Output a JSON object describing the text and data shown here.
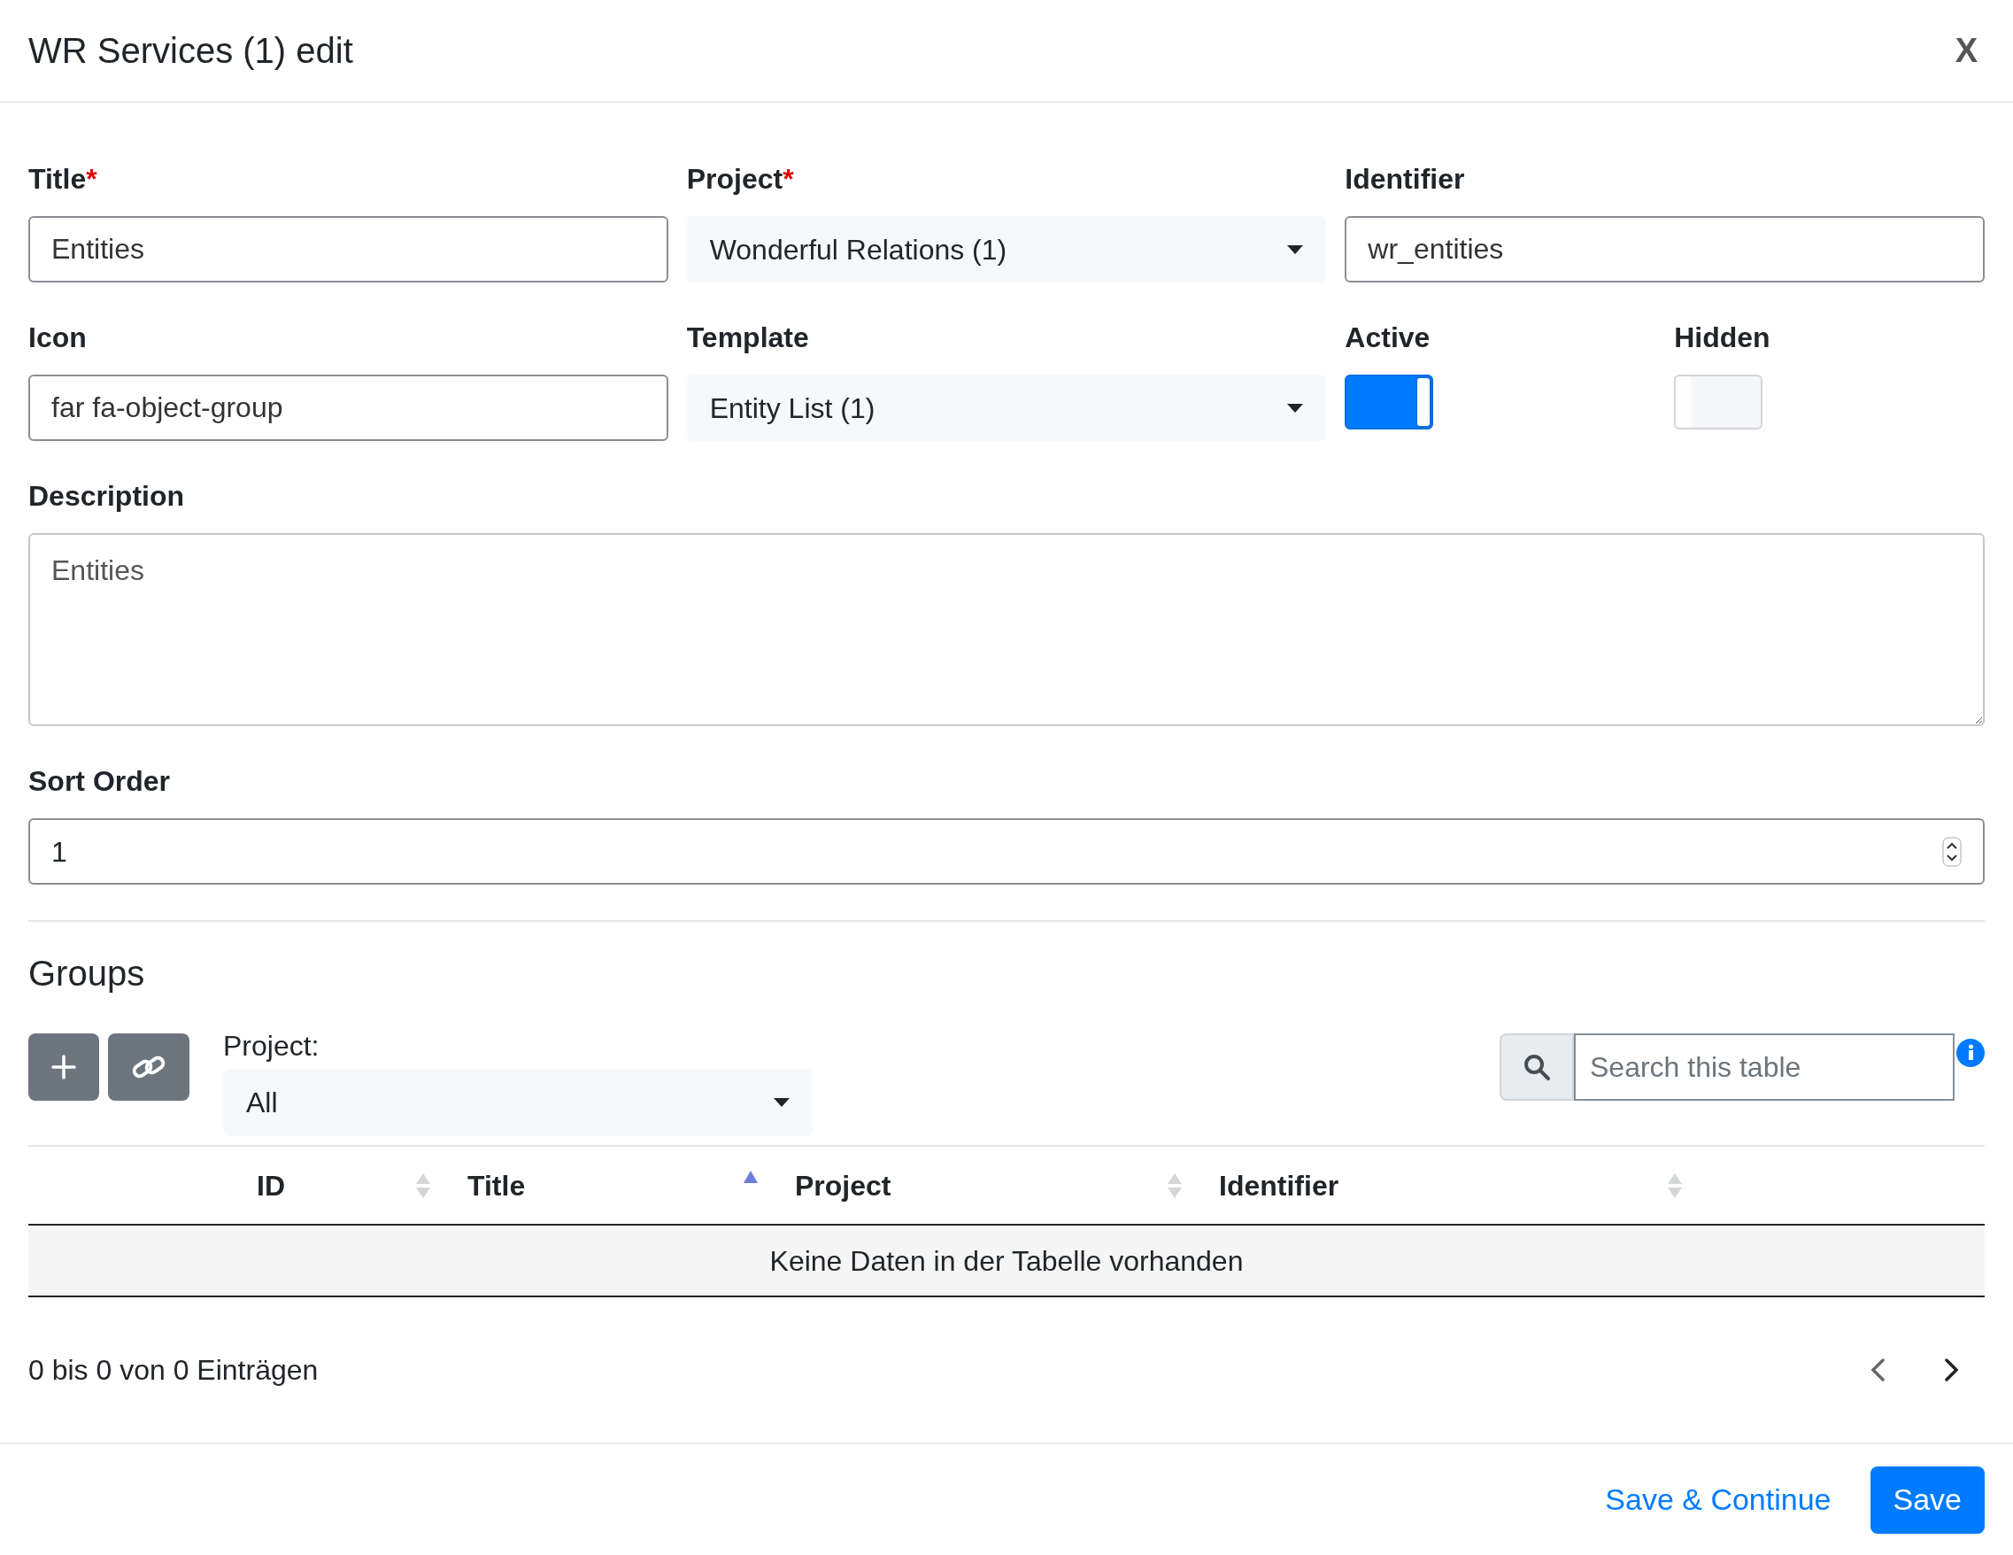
{
  "window": {
    "title": "WR Services (1) edit",
    "close": "X"
  },
  "form_rows": [
    [
      {
        "kind": "text",
        "label": "Title",
        "required_mark": "*",
        "value": "Entities"
      },
      {
        "kind": "select",
        "label": "Project",
        "required_mark": "*",
        "value": "Wonderful Relations (1)"
      },
      {
        "kind": "text",
        "label": "Identifier",
        "value": "wr_entities"
      }
    ],
    [
      {
        "kind": "text",
        "label": "Icon",
        "value": "far fa-object-group"
      },
      {
        "kind": "select",
        "label": "Template",
        "value": "Entity List (1)"
      },
      {
        "kind": "toggle",
        "label": "Active",
        "on": true
      },
      {
        "kind": "toggle",
        "label": "Hidden",
        "on": false
      }
    ],
    [
      {
        "kind": "textarea",
        "label": "Description",
        "value": "Entities"
      }
    ],
    [
      {
        "kind": "number",
        "label": "Sort Order",
        "value": "1"
      }
    ]
  ],
  "groups": {
    "title": "Groups",
    "filter_label": "Project:",
    "filter_value": "All",
    "search_placeholder": "Search this table",
    "columns": [
      {
        "label": "ID",
        "sorted": false
      },
      {
        "label": "Title",
        "sorted": true
      },
      {
        "label": "Project",
        "sorted": false
      },
      {
        "label": "Identifier",
        "sorted": false
      }
    ],
    "empty_message": "Keine Daten in der Tabelle vorhanden",
    "info": "0 bis 0 von 0 Einträgen"
  },
  "footer": {
    "buttons": [
      {
        "kind": "link",
        "label": "Save & Continue"
      },
      {
        "kind": "primary",
        "label": "Save"
      }
    ]
  }
}
